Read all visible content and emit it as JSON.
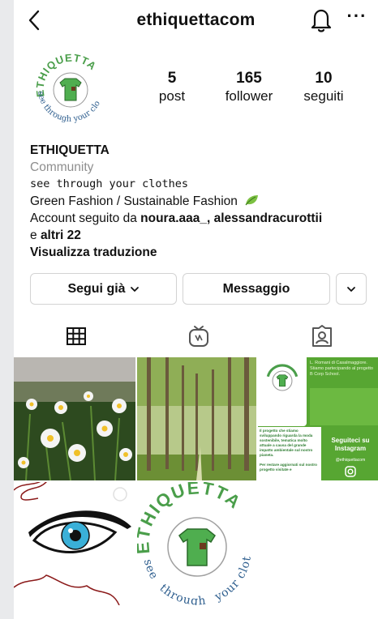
{
  "header": {
    "username": "ethiquettacom",
    "back_icon": "chevron-left-icon",
    "bell_icon": "bell-icon",
    "more_icon": "more-horizontal-icon",
    "more_glyph": "···"
  },
  "profile": {
    "logo_text": "ETHIQUETTA",
    "logo_tagline": "see through your clothes",
    "logo_color": "#4a9e4a",
    "stats": [
      {
        "value": "5",
        "label": "post"
      },
      {
        "value": "165",
        "label": "follower"
      },
      {
        "value": "10",
        "label": "seguiti"
      }
    ]
  },
  "bio": {
    "name": "ETHIQUETTA",
    "category": "Community",
    "tagline": "see through your clothes",
    "description": "Green Fashion / Sustainable Fashion",
    "description_emoji": "leaf-icon",
    "followed_prefix": "Account seguito da ",
    "followed_users": "noura.aaa_, alessandracurottii",
    "followed_and": "e ",
    "followed_more": "altri 22",
    "translate": "Visualizza traduzione"
  },
  "actions": {
    "following_label": "Segui già",
    "message_label": "Messaggio"
  },
  "tabs": [
    "grid-icon",
    "igtv-icon",
    "tagged-icon"
  ],
  "posts": [
    {
      "name": "daisies-photo"
    },
    {
      "name": "poplar-trees-photo"
    },
    {
      "name": "b-corp-school-post",
      "header": "L. Romani di Casalmaggiore. Stiamo partecipando al progetto B Corp School.",
      "body": "Il progetto che stiamo sviluppando riguarda la moda sostenibile, tematica molto attuale a causa del grande impatto ambientale sul nostro pianeta.",
      "body2": "Per restare aggiornati sul nostro progetto visitate e",
      "cta": "Seguiteci su Instagram",
      "handle": "@ethiquettacom"
    },
    {
      "name": "eye-drawing-post"
    },
    {
      "name": "logo-post",
      "logo_text": "ETHIQUETTA",
      "tagline_left": "see",
      "tagline_mid": "through",
      "tagline_right": "your clothes"
    }
  ]
}
